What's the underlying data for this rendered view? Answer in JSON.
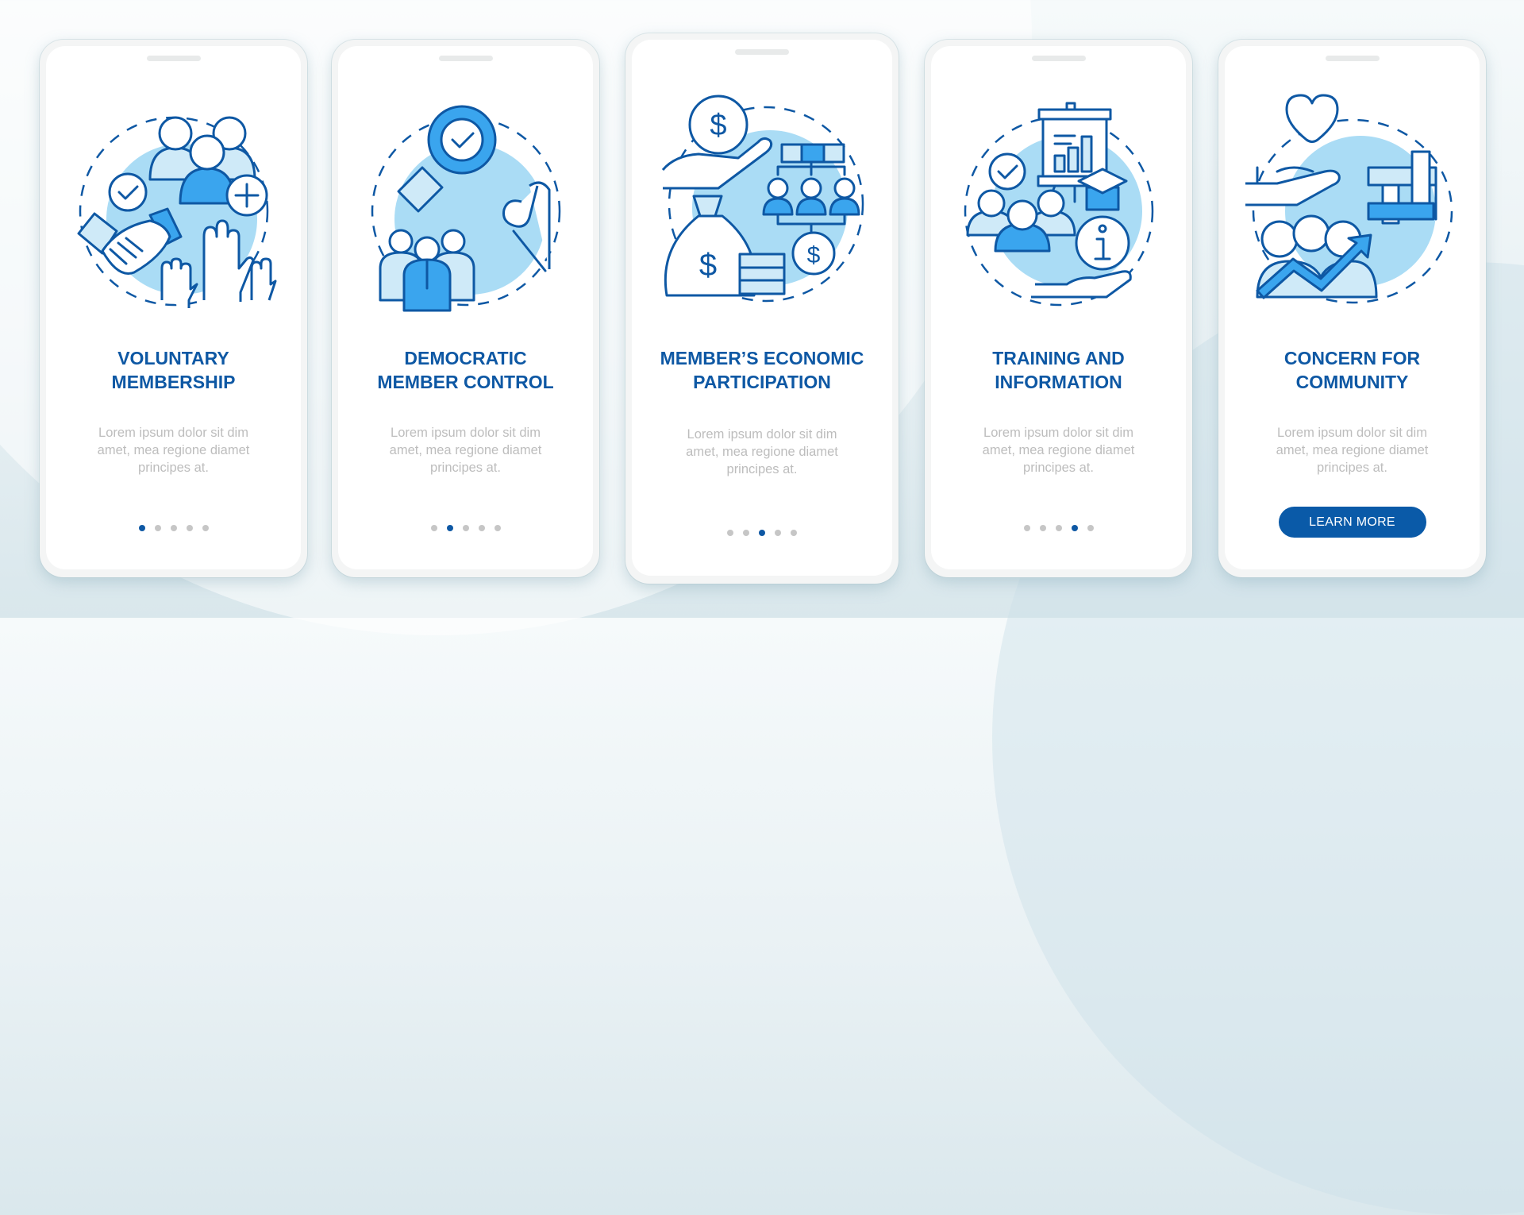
{
  "theme": {
    "accent": "#0E58A4",
    "button": "#0A5AA8",
    "icon_light": "#CFEAF8",
    "icon_medium": "#3AA5EE",
    "blob": "#AADCF5",
    "body_text": "#BDBDBD",
    "dot_inactive": "#C6C6C6"
  },
  "screens": [
    {
      "illustration": "voluntary-membership-icon",
      "title": "VOLUNTARY\nMEMBERSHIP",
      "body": "Lorem ipsum dolor sit dim\namet, mea regione diamet\nprincipes at.",
      "page_index": 1,
      "page_count": 5
    },
    {
      "illustration": "democratic-member-control-icon",
      "title": "DEMOCRATIC\nMEMBER CONTROL",
      "body": "Lorem ipsum dolor sit dim\namet, mea regione diamet\nprincipes at.",
      "page_index": 2,
      "page_count": 5
    },
    {
      "illustration": "economic-participation-icon",
      "title": "MEMBER’S ECONOMIC\nPARTICIPATION",
      "body": "Lorem ipsum dolor sit dim\namet, mea regione diamet\nprincipes at.",
      "page_index": 3,
      "page_count": 5
    },
    {
      "illustration": "training-information-icon",
      "title": "TRAINING AND\nINFORMATION",
      "body": "Lorem ipsum dolor sit dim\namet, mea regione diamet\nprincipes at.",
      "page_index": 4,
      "page_count": 5
    },
    {
      "illustration": "community-concern-icon",
      "title": "CONCERN FOR\nCOMMUNITY",
      "body": "Lorem ipsum dolor sit dim\namet, mea regione diamet\nprincipes at.",
      "button_label": "LEARN MORE"
    }
  ]
}
